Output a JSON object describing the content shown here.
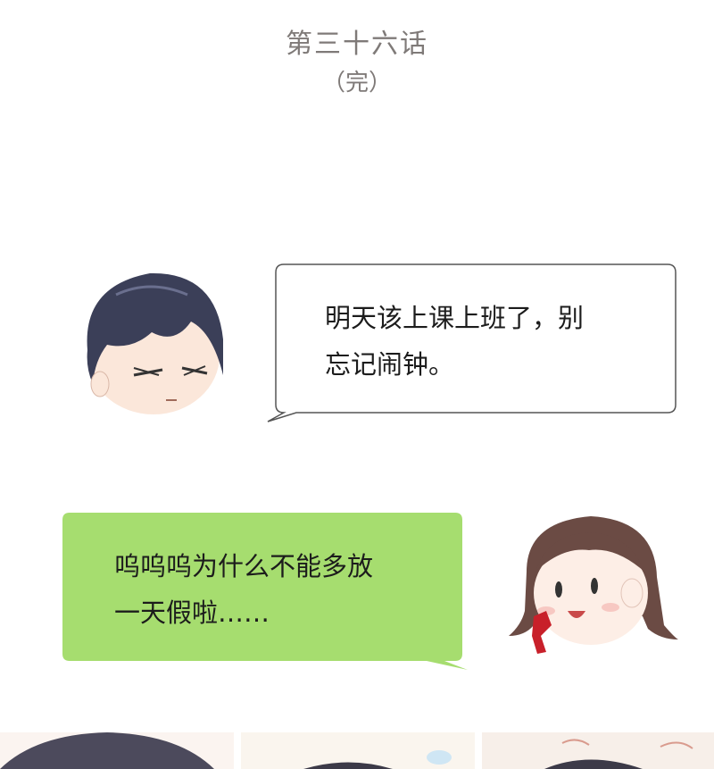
{
  "chapter": {
    "title": "第三十六话",
    "status": "（完）"
  },
  "dialogue": [
    {
      "speaker": "boy",
      "lines": [
        "明天该上课上班了，别",
        "忘记闹钟。"
      ]
    },
    {
      "speaker": "girl",
      "lines": [
        "呜呜呜为什么不能多放",
        "一天假啦……"
      ]
    }
  ],
  "colors": {
    "title": "#7f7a78",
    "green_bubble": "#a6dd6f",
    "white_bubble_border": "#555555"
  }
}
